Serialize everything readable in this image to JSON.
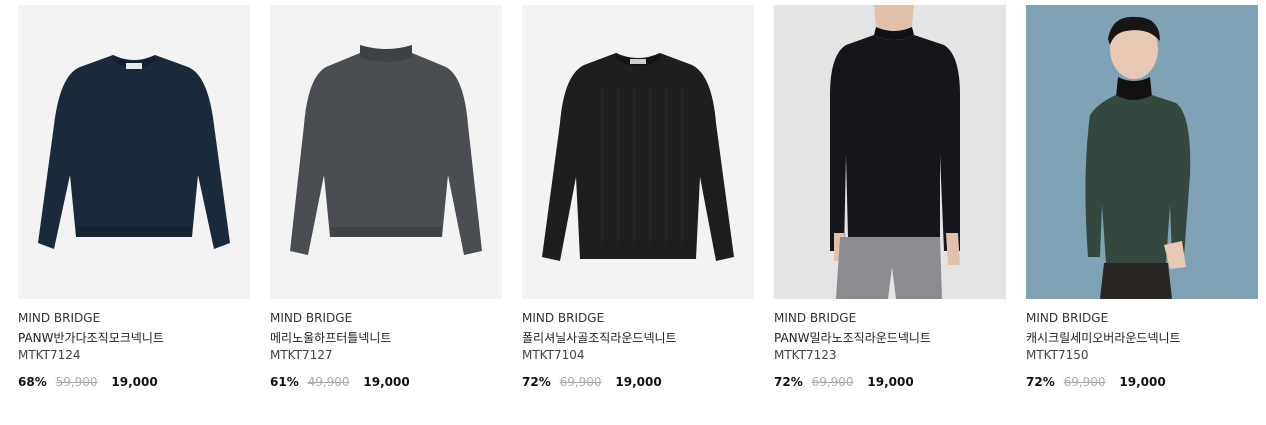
{
  "products": [
    {
      "brand": "MIND BRIDGE",
      "name": "PANW반가다조직모크넥니트",
      "code": "MTKT7124",
      "discount": "68%",
      "original_price": "59,900",
      "sale_price": "19,000",
      "image": {
        "kind": "flat-sweater",
        "background": "#f3f3f3",
        "garment_color": "#1b2a3b"
      }
    },
    {
      "brand": "MIND BRIDGE",
      "name": "메리노울하프터틀넥니트",
      "code": "MTKT7127",
      "discount": "61%",
      "original_price": "49,900",
      "sale_price": "19,000",
      "image": {
        "kind": "flat-sweater",
        "background": "#f3f3f3",
        "garment_color": "#4a4d52"
      }
    },
    {
      "brand": "MIND BRIDGE",
      "name": "폴리셔닐사골조직라운드넥니트",
      "code": "MTKT7104",
      "discount": "72%",
      "original_price": "69,900",
      "sale_price": "19,000",
      "image": {
        "kind": "flat-sweater",
        "background": "#f3f3f3",
        "garment_color": "#1e1e20"
      }
    },
    {
      "brand": "MIND BRIDGE",
      "name": "PANW밀라노조직라운드넥니트",
      "code": "MTKT7123",
      "discount": "72%",
      "original_price": "69,900",
      "sale_price": "19,000",
      "image": {
        "kind": "model-photo",
        "background": "#e4e4e4",
        "garment_color": "#15161c"
      }
    },
    {
      "brand": "MIND BRIDGE",
      "name": "캐시크릴세미오버라운드넥니트",
      "code": "MTKT7150",
      "discount": "72%",
      "original_price": "69,900",
      "sale_price": "19,000",
      "image": {
        "kind": "model-photo",
        "background": "#7fa3b5",
        "garment_color": "#34483f"
      }
    }
  ]
}
